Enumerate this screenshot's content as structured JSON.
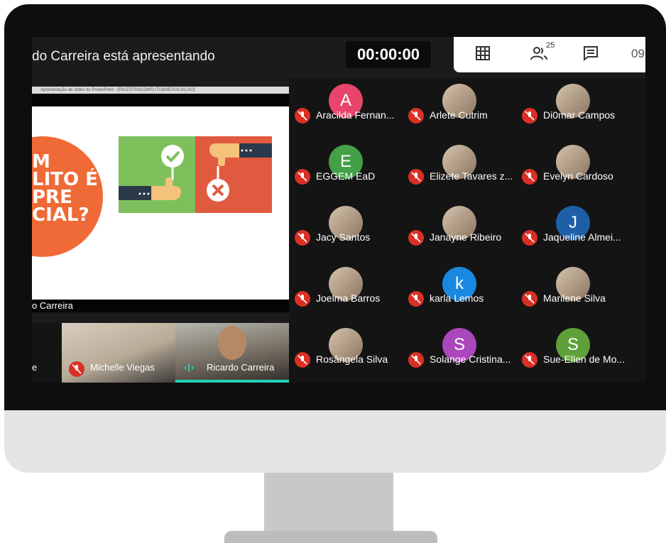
{
  "meeting": {
    "presenting_text": "do Carreira está apresentando",
    "timer": "00:00:00",
    "people_count": "25",
    "clipped_toolbar_text": "09"
  },
  "toolbar": {
    "icons": [
      "grid-view-icon",
      "people-icon",
      "chat-icon"
    ]
  },
  "slide": {
    "window_strip": "Apresentação de slides do PowerPoint - [PALESTRACONFLITO&NEGOCIACAO]",
    "text_lines": [
      "M",
      "LITO É",
      "PRE",
      "CIAL?"
    ],
    "owner_label": "o Carreira"
  },
  "bottom_thumbs": [
    {
      "label": "e"
    },
    {
      "label": "Michelle Viegas"
    },
    {
      "label": "Ricardo Carreira"
    }
  ],
  "participants": [
    {
      "name": "Aracilda Fernan...",
      "initial": "A",
      "color": "#e8456b"
    },
    {
      "name": "Arlete Cutrim",
      "initial": "",
      "color": ""
    },
    {
      "name": "Di0mar Campos",
      "initial": "",
      "color": ""
    },
    {
      "name": "EGGEM EaD",
      "initial": "E",
      "color": "#43a047"
    },
    {
      "name": "Elizete Tavares z...",
      "initial": "",
      "color": ""
    },
    {
      "name": "Evelyn Cardoso",
      "initial": "",
      "color": ""
    },
    {
      "name": "Jacy Santos",
      "initial": "",
      "color": ""
    },
    {
      "name": "Janayne Ribeiro",
      "initial": "",
      "color": ""
    },
    {
      "name": "Jaqueline Almei...",
      "initial": "J",
      "color": "#1e5fa8"
    },
    {
      "name": "Joelma Barros",
      "initial": "",
      "color": ""
    },
    {
      "name": "karla Lemos",
      "initial": "k",
      "color": "#1a88e0"
    },
    {
      "name": "Marilene Silva",
      "initial": "",
      "color": ""
    },
    {
      "name": "Rosângela Silva",
      "initial": "",
      "color": ""
    },
    {
      "name": "Solange Cristina...",
      "initial": "S",
      "color": "#ab47bc"
    },
    {
      "name": "Sue-Ellen de Mo...",
      "initial": "S",
      "color": "#5fa03a"
    }
  ]
}
